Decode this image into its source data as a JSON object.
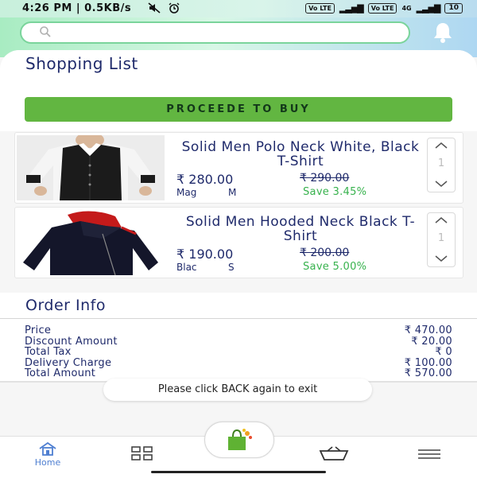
{
  "status_bar": {
    "time": "4:26 PM | 0.5KB/s",
    "icons": [
      "mute-icon",
      "alarm-icon"
    ],
    "network_badge_1": "Vo LTE",
    "network_badge_2": "Vo LTE",
    "network_type": "4G",
    "battery": "10"
  },
  "header": {
    "search_placeholder": "",
    "icons": [
      "search-icon",
      "bell-icon"
    ]
  },
  "shopping_list": {
    "title": "Shopping List",
    "proceed_label": "PROCEEDE TO BUY",
    "items": [
      {
        "name": "Solid Men Polo Neck White, Black T-Shirt",
        "price": "₹ 280.00",
        "original_price": "₹ 290.00",
        "variant": "Mag",
        "size": "M",
        "savings": "Save 3.45%",
        "quantity": "1"
      },
      {
        "name": "Solid Men Hooded Neck Black T-Shirt",
        "price": "₹ 190.00",
        "original_price": "₹ 200.00",
        "variant": "Blac",
        "size": "S",
        "savings": "Save 5.00%",
        "quantity": "1"
      }
    ]
  },
  "order_info": {
    "title": "Order Info",
    "rows": [
      {
        "label": "Price",
        "value": "₹ 470.00"
      },
      {
        "label": "Discount Amount",
        "value": "₹ 20.00"
      },
      {
        "label": "Total Tax",
        "value": "₹ 0"
      },
      {
        "label": "Delivery Charge",
        "value": "₹ 100.00"
      },
      {
        "label": "Total Amount",
        "value": "₹ 570.00"
      }
    ]
  },
  "toast": {
    "message": "Please click BACK again to exit"
  },
  "bottom_nav": {
    "home_label": "Home",
    "icons": [
      "home-icon",
      "grid-icon",
      "shopping-bag-icon",
      "cart-icon",
      "menu-icon"
    ]
  },
  "colors": {
    "accent_green": "#62b641",
    "save_green": "#37b24d",
    "text_navy": "#1f2a6b",
    "home_blue": "#4f7fd1"
  }
}
